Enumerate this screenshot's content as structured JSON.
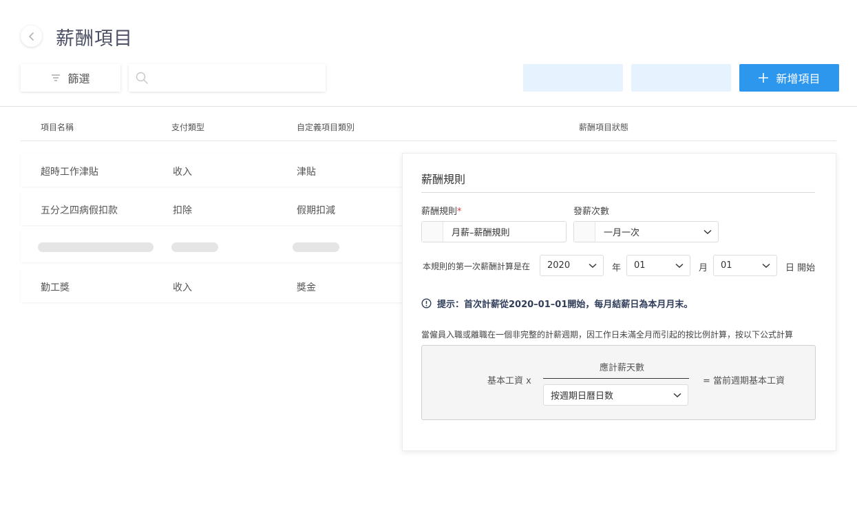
{
  "header": {
    "title": "薪酬項目"
  },
  "toolbar": {
    "filter_label": "篩選",
    "search_placeholder": "",
    "add_label": "新增項目",
    "accent_color": "#2d97ee",
    "ghost_color": "#e6f2fd"
  },
  "table": {
    "headers": [
      "項目名稱",
      "支付類型",
      "自定義項目類別",
      "薪酬項目狀態"
    ],
    "rows": [
      {
        "name": "超時工作津貼",
        "pay_type": "收入",
        "category": "津貼"
      },
      {
        "name": "五分之四病假扣款",
        "pay_type": "扣除",
        "category": "假期扣減"
      },
      {
        "name": "",
        "pay_type": "",
        "category": "",
        "loading": true
      },
      {
        "name": "勤工獎",
        "pay_type": "收入",
        "category": "獎金"
      }
    ]
  },
  "panel": {
    "title": "薪酬規則",
    "rule_label": "薪酬規則",
    "required_mark": "*",
    "rule_value": "月薪–薪酬規則",
    "freq_label": "發薪次數",
    "freq_value": "一月一次",
    "first_calc_prefix": "本規則的第一次薪酬計算是在",
    "year_value": "2020",
    "year_unit": "年",
    "month_value": "01",
    "month_unit": "月",
    "day_value": "01",
    "day_unit": "日 開始",
    "hint": "提示：首次計薪從2020–01–01開始，每月結薪日為本月月末。",
    "description": "當僱員入職或離職在一個非完整的計薪週期，因工作日未滿全月而引起的按比例計算，按以下公式計算",
    "formula": {
      "left": "基本工資 x",
      "numerator": "應計薪天數",
      "denominator": "按週期日曆日数",
      "right": "= 當前週期基本工資"
    }
  }
}
